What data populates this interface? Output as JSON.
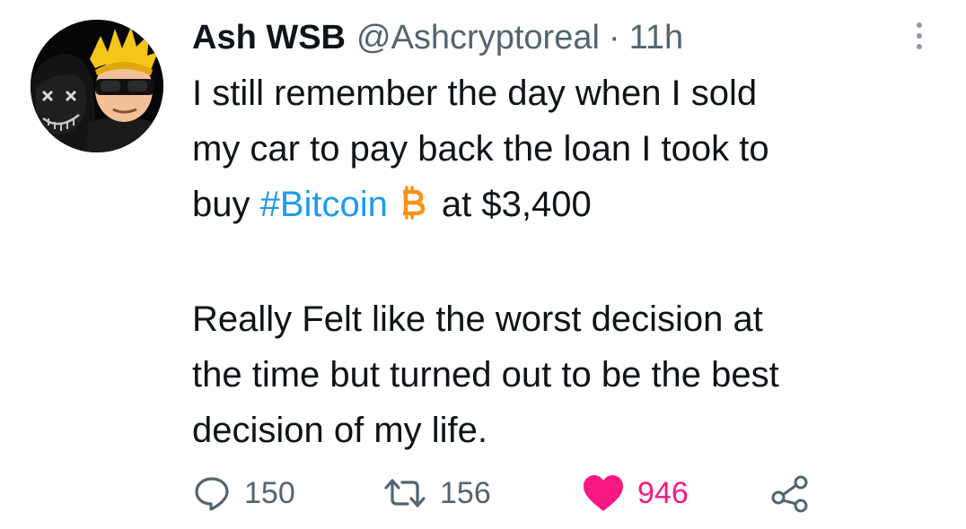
{
  "tweet": {
    "author": {
      "display_name": "Ash WSB",
      "handle": "@Ashcryptoreal"
    },
    "separator": "·",
    "time_ago": "11h",
    "body": {
      "line1": "I still remember the day when I sold",
      "line2": "my car to pay back the loan I took to",
      "line3_prefix": "buy ",
      "hashtag": "#Bitcoin",
      "line3_suffix": "at $3,400",
      "line4": "Really Felt like the worst decision at",
      "line5": "the time but turned out to be the best",
      "line6": "decision of my life."
    },
    "actions": {
      "replies": "150",
      "retweets": "156",
      "likes": "946"
    }
  },
  "colors": {
    "text": "#0f1419",
    "secondary": "#536471",
    "hashtag": "#1d9bf0",
    "like": "#f91880",
    "bitcoin": "#f7931a"
  },
  "icons": {
    "more": "more-vertical-icon",
    "bitcoin": "bitcoin-icon",
    "reply": "reply-icon",
    "retweet": "retweet-icon",
    "like": "heart-icon",
    "share": "share-icon"
  }
}
